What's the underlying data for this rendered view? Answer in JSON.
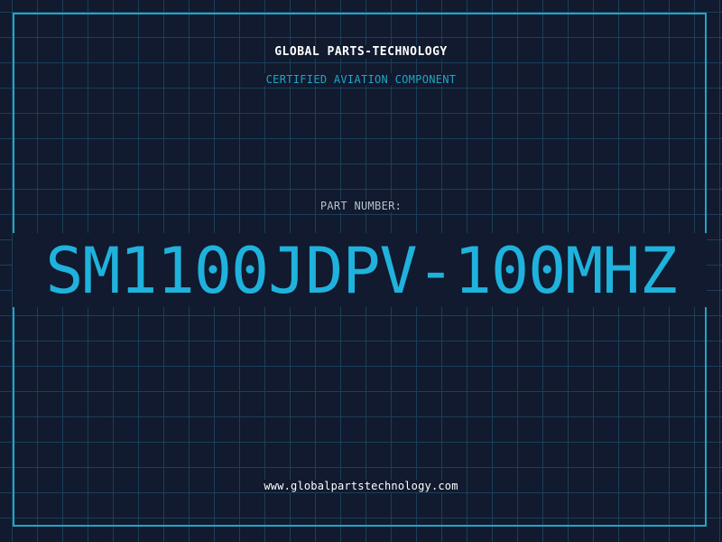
{
  "header": {
    "company_name": "GLOBAL PARTS-TECHNOLOGY",
    "certification": "CERTIFIED AVIATION COMPONENT"
  },
  "part": {
    "label": "PART NUMBER:",
    "number": "SM1100JDPV-100MHZ"
  },
  "footer": {
    "website": "www.globalpartstechnology.com"
  },
  "colors": {
    "background": "#111a2e",
    "grid": "#1a4058",
    "accent": "#1fa5c9",
    "part_number": "#1fb2dc",
    "text_primary": "#ffffff",
    "text_secondary": "#b8bfcc"
  }
}
